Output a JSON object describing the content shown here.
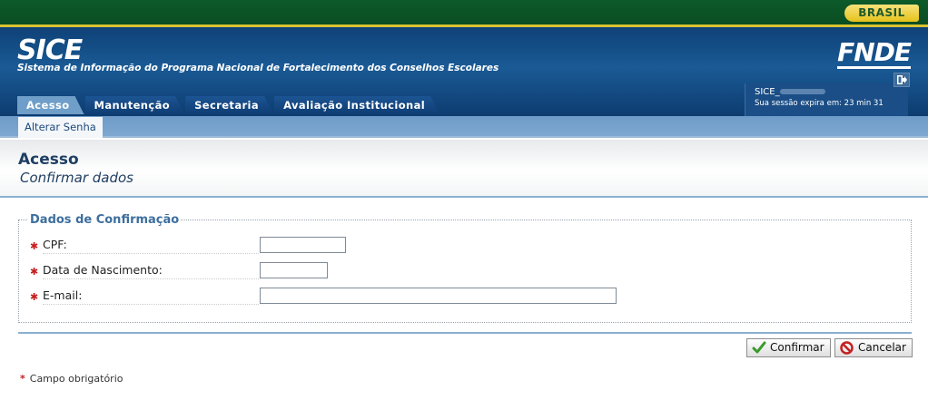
{
  "gov_bar": {
    "badge": "BRASIL"
  },
  "header": {
    "title": "SICE",
    "subtitle": "Sistema de Informação do Programa Nacional de Fortalecimento dos Conselhos Escolares",
    "logo_text": "FNDE"
  },
  "tabs": [
    {
      "label": "Acesso",
      "active": true
    },
    {
      "label": "Manutenção",
      "active": false
    },
    {
      "label": "Secretaria",
      "active": false
    },
    {
      "label": "Avaliação Institucional",
      "active": false
    }
  ],
  "session": {
    "user_prefix": "SICE_",
    "expiry_text": "Sua sessão expira em: 23 min 31"
  },
  "subnav": {
    "items": [
      {
        "label": "Alterar Senha"
      }
    ]
  },
  "page": {
    "title": "Acesso",
    "subtitle": "Confirmar dados"
  },
  "form": {
    "legend": "Dados de Confirmação",
    "fields": [
      {
        "label": "CPF:",
        "value": "",
        "required": true
      },
      {
        "label": "Data de Nascimento:",
        "value": "",
        "required": true
      },
      {
        "label": "E-mail:",
        "value": "",
        "required": true
      }
    ]
  },
  "buttons": {
    "confirm": "Confirmar",
    "cancel": "Cancelar"
  },
  "footer_note": {
    "star": "*",
    "text": "Campo obrigatório"
  },
  "colors": {
    "gov_green": "#0d5a2a",
    "header_blue": "#0e4177",
    "accent_blue": "#3d6e9d",
    "required_red": "#c42020"
  }
}
